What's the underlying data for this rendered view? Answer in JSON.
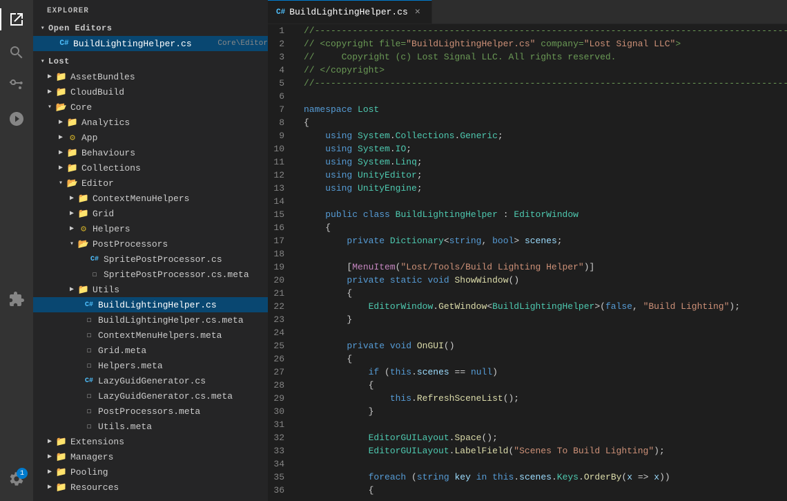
{
  "activityBar": {
    "icons": [
      {
        "name": "explorer-icon",
        "symbol": "⎘",
        "active": true,
        "label": "Explorer"
      },
      {
        "name": "search-icon",
        "symbol": "🔍",
        "active": false,
        "label": "Search"
      },
      {
        "name": "source-control-icon",
        "symbol": "⑂",
        "active": false,
        "label": "Source Control"
      },
      {
        "name": "extensions-icon",
        "symbol": "⊞",
        "active": false,
        "label": "Extensions"
      },
      {
        "name": "debug-icon",
        "symbol": "⬡",
        "active": false,
        "label": "Run and Debug"
      }
    ],
    "bottomIcons": [
      {
        "name": "settings-icon",
        "symbol": "⚙",
        "label": "Settings",
        "badge": "1"
      }
    ]
  },
  "sidebar": {
    "title": "Explorer",
    "sections": {
      "openEditors": {
        "label": "Open Editors",
        "items": [
          {
            "name": "BuildLightingHelper.cs",
            "type": "cs",
            "path": "Core\\Editor",
            "selected": true
          }
        ]
      },
      "lost": {
        "label": "Lost",
        "items": [
          {
            "name": "AssetBundles",
            "type": "folder",
            "depth": 1,
            "expanded": false
          },
          {
            "name": "CloudBuild",
            "type": "folder",
            "depth": 1,
            "expanded": false
          },
          {
            "name": "Core",
            "type": "folder",
            "depth": 1,
            "expanded": true,
            "children": [
              {
                "name": "Analytics",
                "type": "folder",
                "depth": 2,
                "expanded": false
              },
              {
                "name": "App",
                "type": "folder-gear",
                "depth": 2,
                "expanded": false
              },
              {
                "name": "Behaviours",
                "type": "folder",
                "depth": 2,
                "expanded": false
              },
              {
                "name": "Collections",
                "type": "folder",
                "depth": 2,
                "expanded": false
              },
              {
                "name": "Editor",
                "type": "folder",
                "depth": 2,
                "expanded": true,
                "children": [
                  {
                    "name": "ContextMenuHelpers",
                    "type": "folder",
                    "depth": 3,
                    "expanded": false
                  },
                  {
                    "name": "Grid",
                    "type": "folder",
                    "depth": 3,
                    "expanded": false
                  },
                  {
                    "name": "Helpers",
                    "type": "folder-gear",
                    "depth": 3,
                    "expanded": false
                  },
                  {
                    "name": "PostProcessors",
                    "type": "folder",
                    "depth": 3,
                    "expanded": true,
                    "children": [
                      {
                        "name": "SpritePostProcessor.cs",
                        "type": "cs",
                        "depth": 4
                      },
                      {
                        "name": "SpritePostProcessor.cs.meta",
                        "type": "meta",
                        "depth": 4
                      }
                    ]
                  },
                  {
                    "name": "Utils",
                    "type": "folder",
                    "depth": 3,
                    "expanded": false
                  },
                  {
                    "name": "BuildLightingHelper.cs",
                    "type": "cs",
                    "depth": 3,
                    "selected": true
                  },
                  {
                    "name": "BuildLightingHelper.cs.meta",
                    "type": "meta",
                    "depth": 3
                  },
                  {
                    "name": "ContextMenuHelpers.meta",
                    "type": "meta",
                    "depth": 3
                  },
                  {
                    "name": "Grid.meta",
                    "type": "meta",
                    "depth": 3
                  },
                  {
                    "name": "Helpers.meta",
                    "type": "meta",
                    "depth": 3
                  },
                  {
                    "name": "LazyGuidGenerator.cs",
                    "type": "cs",
                    "depth": 3
                  },
                  {
                    "name": "LazyGuidGenerator.cs.meta",
                    "type": "meta",
                    "depth": 3
                  },
                  {
                    "name": "PostProcessors.meta",
                    "type": "meta",
                    "depth": 3
                  },
                  {
                    "name": "Utils.meta",
                    "type": "meta",
                    "depth": 3
                  }
                ]
              }
            ]
          },
          {
            "name": "Extensions",
            "type": "folder",
            "depth": 1,
            "expanded": false
          },
          {
            "name": "Managers",
            "type": "folder",
            "depth": 1,
            "expanded": false
          },
          {
            "name": "Pooling",
            "type": "folder",
            "depth": 1,
            "expanded": false
          },
          {
            "name": "Resources",
            "type": "folder",
            "depth": 1,
            "expanded": false
          }
        ]
      }
    }
  },
  "editor": {
    "tab": {
      "filename": "BuildLightingHelper.cs",
      "icon": "C#",
      "modified": false
    },
    "lines": [
      {
        "num": 1,
        "content": "//--------------------------------------------------------------"
      },
      {
        "num": 2,
        "content": "// <copyright file=\"BuildLightingHelper.cs\" company=\"Lost Signal LLC\">"
      },
      {
        "num": 3,
        "content": "//     Copyright (c) Lost Signal LLC. All rights reserved."
      },
      {
        "num": 4,
        "content": "// </copyright>"
      },
      {
        "num": 5,
        "content": "//--------------------------------------------------------------"
      },
      {
        "num": 6,
        "content": ""
      },
      {
        "num": 7,
        "content": "namespace Lost"
      },
      {
        "num": 8,
        "content": "{"
      },
      {
        "num": 9,
        "content": "    using System.Collections.Generic;"
      },
      {
        "num": 10,
        "content": "    using System.IO;"
      },
      {
        "num": 11,
        "content": "    using System.Linq;"
      },
      {
        "num": 12,
        "content": "    using UnityEditor;"
      },
      {
        "num": 13,
        "content": "    using UnityEngine;"
      },
      {
        "num": 14,
        "content": ""
      },
      {
        "num": 15,
        "content": "    public class BuildLightingHelper : EditorWindow"
      },
      {
        "num": 16,
        "content": "    {"
      },
      {
        "num": 17,
        "content": "        private Dictionary<string, bool> scenes;"
      },
      {
        "num": 18,
        "content": ""
      },
      {
        "num": 19,
        "content": "        [MenuItem(\"Lost/Tools/Build Lighting Helper\")]"
      },
      {
        "num": 20,
        "content": "        private static void ShowWindow()"
      },
      {
        "num": 21,
        "content": "        {"
      },
      {
        "num": 22,
        "content": "            EditorWindow.GetWindow<BuildLightingHelper>(false, \"Build Lighting\");"
      },
      {
        "num": 23,
        "content": "        }"
      },
      {
        "num": 24,
        "content": ""
      },
      {
        "num": 25,
        "content": "        private void OnGUI()"
      },
      {
        "num": 26,
        "content": "        {"
      },
      {
        "num": 27,
        "content": "            if (this.scenes == null)"
      },
      {
        "num": 28,
        "content": "            {"
      },
      {
        "num": 29,
        "content": "                this.RefreshSceneList();"
      },
      {
        "num": 30,
        "content": "            }"
      },
      {
        "num": 31,
        "content": ""
      },
      {
        "num": 32,
        "content": "            EditorGUILayout.Space();"
      },
      {
        "num": 33,
        "content": "            EditorGUILayout.LabelField(\"Scenes To Build Lighting\");"
      },
      {
        "num": 34,
        "content": ""
      },
      {
        "num": 35,
        "content": "            foreach (string key in this.scenes.Keys.OrderBy(x => x))"
      },
      {
        "num": 36,
        "content": "            {"
      }
    ]
  }
}
